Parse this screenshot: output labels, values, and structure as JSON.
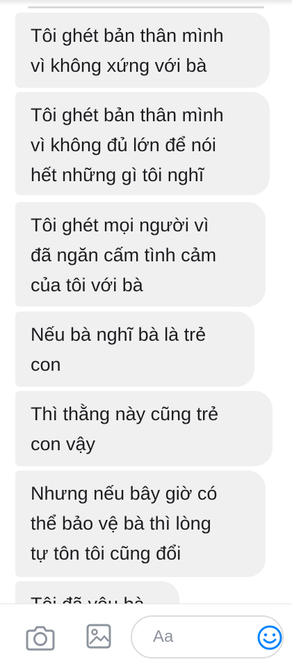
{
  "conversation": {
    "messages": [
      {
        "text": "Tôi ghét bản thân mình\nvì không xứng với bà"
      },
      {
        "text": "Tôi ghét bản thân mình\nvì không đủ lớn để nói\nhết những gì tôi nghĩ"
      },
      {
        "text": "Tôi ghét mọi người vì\nđã ngăn cấm tình cảm\ncủa tôi với bà"
      },
      {
        "text": "Nếu bà nghĩ bà là trẻ\ncon"
      },
      {
        "text": "Thì thằng này cũng trẻ\ncon vậy"
      },
      {
        "text": "Nhưng nếu bây giờ có\nthể bảo vệ bà thì lòng\ntự tôn tôi cũng đổi"
      },
      {
        "text": "Tôi đã yêu bà"
      }
    ]
  },
  "composer": {
    "input_placeholder": "Aa",
    "camera_icon": "camera-icon",
    "gallery_icon": "image-icon",
    "emoji_icon": "smiley-icon"
  },
  "colors": {
    "bubble": "#f1f0f0",
    "text": "#1c1e21",
    "accent": "#0084ff",
    "icon": "#8d949e"
  }
}
